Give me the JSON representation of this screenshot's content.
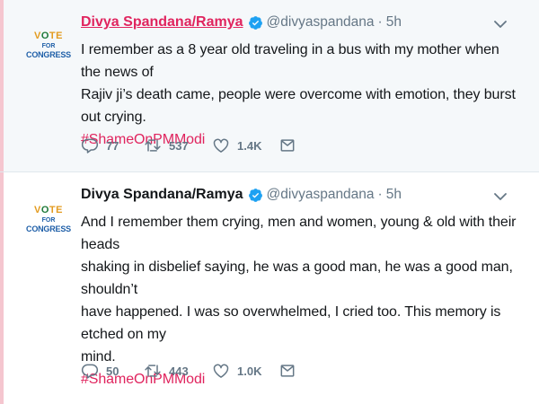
{
  "tweets": [
    {
      "display_name": "Divya Spandana/Ramya",
      "handle": "@divyaspandana",
      "separator": "·",
      "time": "5h",
      "avatar": {
        "vote": "VOTE",
        "for": "FOR",
        "congress": "CONGRESS"
      },
      "body_lines": [
        "I remember as a 8 year old traveling in a bus with my mother when the news of",
        "Rajiv ji’s death came, people were overcome with emotion, they burst out crying."
      ],
      "hashtag": "#ShameOnPMModi",
      "replies": "77",
      "retweets": "537",
      "likes": "1.4K"
    },
    {
      "display_name": "Divya Spandana/Ramya",
      "handle": "@divyaspandana",
      "separator": "·",
      "time": "5h",
      "avatar": {
        "vote": "VOTE",
        "for": "FOR",
        "congress": "CONGRESS"
      },
      "body_lines": [
        "And I remember them crying, men and women, young & old with their heads",
        "shaking in disbelief saying, he was a good man, he was a good man, shouldn’t",
        "have happened. I was so overwhelmed, I cried too. This memory is etched on my",
        "mind."
      ],
      "hashtag": "#ShameOnPMModi",
      "replies": "50",
      "retweets": "443",
      "likes": "1.0K"
    }
  ],
  "colors": {
    "hashtag": "#e0245e",
    "verified": "#1da1f2",
    "muted": "#657786",
    "rail": "#f5c6cf"
  },
  "icons": {
    "reply": "reply-icon",
    "retweet": "retweet-icon",
    "like": "like-icon",
    "dm": "direct-message-icon",
    "verified": "verified-badge-icon",
    "caret": "chevron-down-icon"
  }
}
